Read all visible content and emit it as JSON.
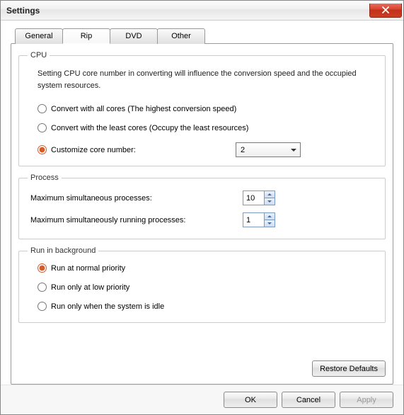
{
  "window": {
    "title": "Settings"
  },
  "tabs": [
    {
      "label": "General"
    },
    {
      "label": "Rip"
    },
    {
      "label": "DVD"
    },
    {
      "label": "Other"
    }
  ],
  "cpu": {
    "legend": "CPU",
    "description": "Setting CPU core number in converting will influence the conversion speed and the occupied system resources.",
    "opt_all": "Convert with all cores (The highest conversion speed)",
    "opt_least": "Convert with the least cores (Occupy the least resources)",
    "opt_custom": "Customize core number:",
    "core_value": "2"
  },
  "process": {
    "legend": "Process",
    "max_sim": "Maximum simultaneous processes:",
    "max_sim_val": "10",
    "max_run": "Maximum simultaneously running processes:",
    "max_run_val": "1"
  },
  "background": {
    "legend": "Run in background",
    "opt_normal": "Run at normal priority",
    "opt_low": "Run only at low priority",
    "opt_idle": "Run only when the system is idle"
  },
  "buttons": {
    "restore": "Restore Defaults",
    "ok": "OK",
    "cancel": "Cancel",
    "apply": "Apply"
  }
}
